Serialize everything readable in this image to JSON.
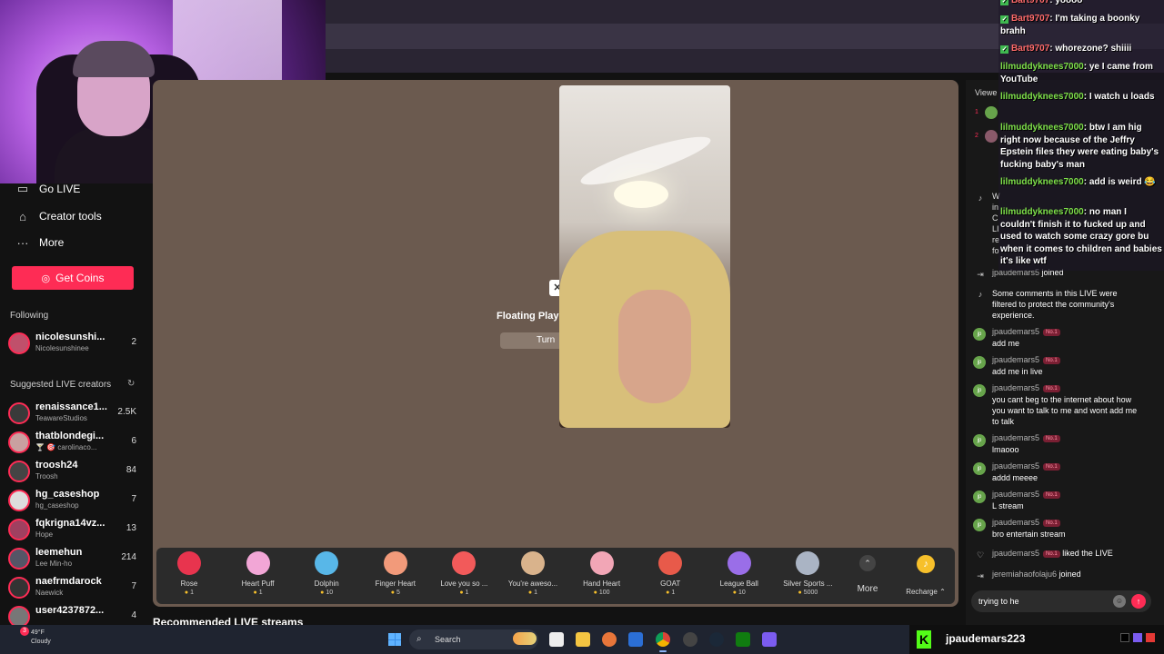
{
  "sidebar": {
    "nav": [
      {
        "label": "Go LIVE",
        "icon": "camera-icon"
      },
      {
        "label": "Creator tools",
        "icon": "creator-tools-icon"
      },
      {
        "label": "More",
        "icon": "more-dots-icon"
      }
    ],
    "get_coins": "Get Coins",
    "following_title": "Following",
    "following": [
      {
        "name": "nicolesunshi...",
        "sub": "Nicolesunshinee",
        "count": "2"
      }
    ],
    "suggested_title": "Suggested LIVE creators",
    "suggested": [
      {
        "name": "renaissance1...",
        "sub": "TeawareStudios",
        "count": "2.5K"
      },
      {
        "name": "thatblondegi...",
        "sub": "🍸 🎯 carolinaco...",
        "count": "6"
      },
      {
        "name": "troosh24",
        "sub": "Troosh",
        "count": "84"
      },
      {
        "name": "hg_caseshop",
        "sub": "hg_caseshop",
        "count": "7"
      },
      {
        "name": "fqkrigna14vz...",
        "sub": "Hope",
        "count": "13"
      },
      {
        "name": "leemehun",
        "sub": "Lee Min-ho",
        "count": "214"
      },
      {
        "name": "naefrmdarock",
        "sub": "Naewick",
        "count": "7"
      },
      {
        "name": "user4237872...",
        "sub": "",
        "count": "4"
      }
    ]
  },
  "player": {
    "floating_title": "Floating Playe",
    "floating_button": "Turn"
  },
  "gifts": [
    {
      "name": "Rose",
      "price": "1",
      "icon": "rose-icon",
      "color": "#e8344e"
    },
    {
      "name": "Heart Puff",
      "price": "1",
      "icon": "heart-puff-icon",
      "color": "#f2a6d6"
    },
    {
      "name": "Dolphin",
      "price": "10",
      "icon": "dolphin-icon",
      "color": "#58b7e8"
    },
    {
      "name": "Finger Heart",
      "price": "5",
      "icon": "finger-heart-icon",
      "color": "#f29a7a"
    },
    {
      "name": "Love you so ...",
      "price": "1",
      "icon": "love-icon",
      "color": "#f25a5a"
    },
    {
      "name": "You're aweso...",
      "price": "1",
      "icon": "cat-icon",
      "color": "#d9b38c"
    },
    {
      "name": "Hand Heart",
      "price": "100",
      "icon": "hand-heart-icon",
      "color": "#f2a6b6"
    },
    {
      "name": "GOAT",
      "price": "1",
      "icon": "goat-icon",
      "color": "#e85a4a"
    },
    {
      "name": "League Ball",
      "price": "10",
      "icon": "league-ball-icon",
      "color": "#9a6ee8"
    },
    {
      "name": "Silver Sports ...",
      "price": "5000",
      "icon": "car-icon",
      "color": "#aab4c4"
    }
  ],
  "gift_more": "More",
  "recharge": "Recharge ⌃",
  "recommended_title": "Recommended LIVE streams",
  "chat": {
    "viewers_label": "Viewe",
    "viewer_ranks": [
      "1",
      "2"
    ],
    "messages": [
      {
        "user": "jpaudemars5",
        "badge": "No.1",
        "text": "add me"
      },
      {
        "user": "jpaudemars5",
        "badge": "No.1",
        "text": "add me in live"
      },
      {
        "user": "jpaudemars5",
        "badge": "No.1",
        "text": "you cant beg to the internet about how you want to talk to me and wont add me to talk"
      },
      {
        "user": "jpaudemars5",
        "badge": "No.1",
        "text": "lmaooo"
      },
      {
        "user": "jpaudemars5",
        "badge": "No.1",
        "text": "addd meeee"
      },
      {
        "user": "jpaudemars5",
        "badge": "No.1",
        "text": "L stream"
      },
      {
        "user": "jpaudemars5",
        "badge": "No.1",
        "text": "bro entertain stream"
      }
    ],
    "joined_top": {
      "user": "jpaudemars5",
      "action": "joined"
    },
    "system_msg": "Some comments in this LIVE were filtered to protect the community's experience.",
    "partial_msg": [
      "W",
      "in",
      "C",
      "LI",
      "re",
      "fo"
    ],
    "liked": {
      "user": "jpaudemars5",
      "badge": "No.1",
      "action": "liked the LIVE"
    },
    "joined": {
      "user": "jeremiahaofolaju6",
      "action": "joined"
    },
    "input_value": "trying to he"
  },
  "overlay_chat": [
    {
      "user": "Bart9707",
      "text": "yoooo",
      "kind": "bart"
    },
    {
      "user": "Bart9707",
      "text": "I'm taking a boonky brahh",
      "kind": "bart"
    },
    {
      "user": "Bart9707",
      "text": "whorezone? shiiii",
      "kind": "bart"
    },
    {
      "user": "lilmuddyknees7000",
      "text": "ye I came from YouTube",
      "kind": "green"
    },
    {
      "user": "lilmuddyknees7000",
      "text": "I watch u loads",
      "kind": "green"
    },
    {
      "user": "lilmuddyknees7000",
      "text": "btw I am hig right now because of the Jeffry Epstein files they were eating baby's fucking baby's man",
      "kind": "green"
    },
    {
      "user": "lilmuddyknees7000",
      "text": "add is weird 😂",
      "kind": "green"
    },
    {
      "user": "lilmuddyknees7000",
      "text": "no man I couldn't finish it to fucked up and used to watch some crazy gore bu when it comes to children and babies it's like wtf",
      "kind": "green"
    }
  ],
  "taskbar": {
    "temp": "49°F",
    "weather": "Cloudy",
    "notif_count": "3",
    "search": "Search"
  },
  "kick": {
    "logo": "K",
    "username": "jpaudemars223"
  },
  "colors": {
    "accent": "#fe2c55",
    "kick_green": "#53fc18",
    "chat_user_green": "#7ee04a"
  }
}
